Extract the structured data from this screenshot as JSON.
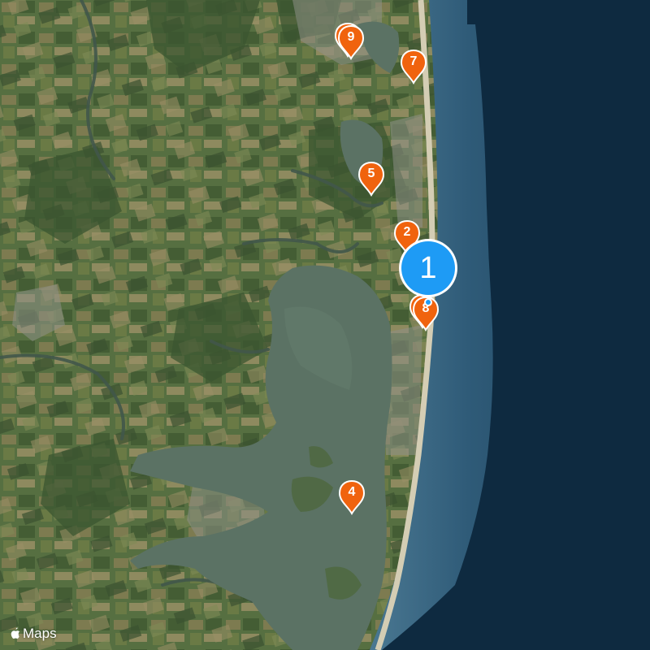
{
  "map": {
    "type": "satellite",
    "colors": {
      "land": "#566f41",
      "field_light": "#8b8a5a",
      "forest": "#3e5732",
      "bay": "#5e7465",
      "ocean_shallow": "#3e6a86",
      "ocean_deep": "#0f2a3f",
      "beach": "#cfc7ae",
      "marker_orange": "#f0630e",
      "marker_selected": "#1e9bf5"
    }
  },
  "markers": [
    {
      "id": "marker-9",
      "label": "9",
      "stacked": true
    },
    {
      "id": "marker-7",
      "label": "7",
      "stacked": false
    },
    {
      "id": "marker-5",
      "label": "5",
      "stacked": false
    },
    {
      "id": "marker-2",
      "label": "2",
      "stacked": false
    },
    {
      "id": "marker-8",
      "label": "8",
      "stacked": true
    },
    {
      "id": "marker-4",
      "label": "4",
      "stacked": false
    }
  ],
  "selected_marker": {
    "label": "1"
  },
  "attribution": {
    "brand_icon": "apple-logo-icon",
    "text": "Maps"
  }
}
